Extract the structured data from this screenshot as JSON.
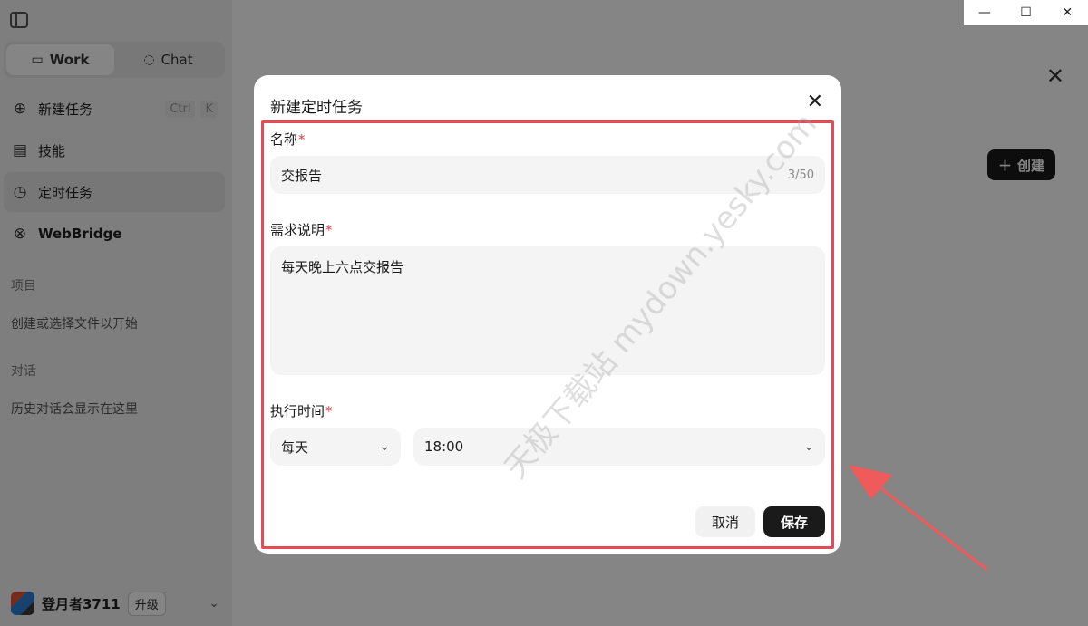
{
  "sidebar": {
    "mode_tabs": [
      {
        "label": "Work",
        "icon": "monitor-icon",
        "active": true
      },
      {
        "label": "Chat",
        "icon": "chat-bubble-icon",
        "active": false
      }
    ],
    "items": [
      {
        "label": "新建任务",
        "icon": "plus-circle-icon",
        "shortcut": [
          "Ctrl",
          "K"
        ]
      },
      {
        "label": "技能",
        "icon": "book-icon"
      },
      {
        "label": "定时任务",
        "icon": "alarm-clock-icon",
        "active": true
      },
      {
        "label": "WebBridge",
        "icon": "webbridge-icon"
      }
    ],
    "projects_title": "项目",
    "projects_hint": "创建或选择文件以开始",
    "conversations_title": "对话",
    "conversations_hint": "历史对话会显示在这里",
    "user": {
      "name": "登月者3711",
      "upgrade_label": "升级"
    }
  },
  "main": {
    "create_label": "创建"
  },
  "modal": {
    "title": "新建定时任务",
    "name_label": "名称",
    "name_value": "交报告",
    "name_count": "3/50",
    "desc_label": "需求说明",
    "desc_value": "每天晚上六点交报告",
    "time_label": "执行时间",
    "frequency_value": "每天",
    "time_value": "18:00",
    "required_mark": "*",
    "cancel_label": "取消",
    "save_label": "保存"
  },
  "watermark": "天极下载站 mydown.yesky.com",
  "colors": {
    "highlight": "#e64b55",
    "primary": "#1a1a1a"
  }
}
